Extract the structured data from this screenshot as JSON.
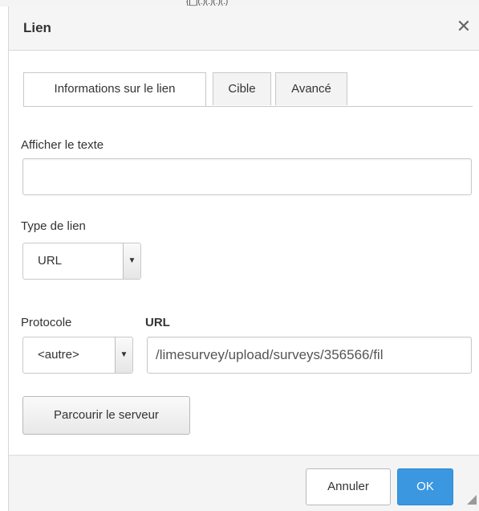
{
  "top_fragment": "{[_](.)(.)(.)(.)",
  "dialog": {
    "title": "Lien",
    "close_icon": "close-icon"
  },
  "tabs": [
    {
      "label": "Informations sur le lien",
      "active": true
    },
    {
      "label": "Cible",
      "active": false
    },
    {
      "label": "Avancé",
      "active": false
    }
  ],
  "fields": {
    "display_text_label": "Afficher le texte",
    "display_text_value": "",
    "link_type_label": "Type de lien",
    "link_type_value": "URL",
    "protocol_label": "Protocole",
    "protocol_value": "<autre>",
    "url_label": "URL",
    "url_value": "/limesurvey/upload/surveys/356566/fil"
  },
  "buttons": {
    "browse_server": "Parcourir le serveur",
    "cancel": "Annuler",
    "ok": "OK"
  },
  "icons": {
    "dropdown": "dropdown-arrow-icon",
    "resize": "resize-grip-icon"
  },
  "colors": {
    "primary": "#3a97e0",
    "header_bg": "#f5f5f5",
    "border": "#c9c9c9"
  }
}
